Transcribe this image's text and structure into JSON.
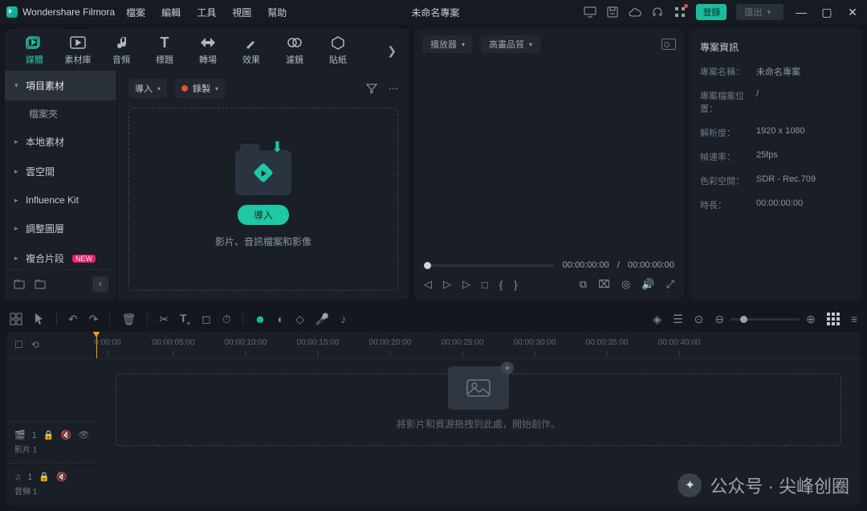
{
  "titlebar": {
    "brand": "Wondershare Filmora",
    "menu": [
      "檔案",
      "編輯",
      "工具",
      "視圖",
      "幫助"
    ],
    "project": "未命名專案",
    "login_label": "登錄",
    "export_label": "匯出"
  },
  "tabs": [
    {
      "id": "media",
      "label": "媒體",
      "active": true
    },
    {
      "id": "stock",
      "label": "素材庫"
    },
    {
      "id": "audio",
      "label": "音頻"
    },
    {
      "id": "title",
      "label": "標題"
    },
    {
      "id": "transition",
      "label": "轉場"
    },
    {
      "id": "effect",
      "label": "效果"
    },
    {
      "id": "filter",
      "label": "濾鏡"
    },
    {
      "id": "sticker",
      "label": "貼紙"
    }
  ],
  "sidebar": {
    "items": [
      {
        "label": "項目素材",
        "active": true
      },
      {
        "label": "本地素材"
      },
      {
        "label": "雲空間"
      },
      {
        "label": "Influence Kit"
      },
      {
        "label": "調整圖層"
      },
      {
        "label": "複合片段",
        "badge": "NEW"
      }
    ],
    "sub_label": "檔案夾"
  },
  "mediabar": {
    "import_label": "導入",
    "record_label": "錄製"
  },
  "dropzone": {
    "button": "導入",
    "hint": "影片、音訊檔案和影像"
  },
  "preview": {
    "player_label": "播放器",
    "quality_label": "高畫品質",
    "time_current": "00:00:00:00",
    "time_total": "00:00:00:00"
  },
  "info": {
    "title": "專案資訊",
    "rows": [
      {
        "k": "專案名稱：",
        "v": "未命名專案"
      },
      {
        "k": "專案檔案位置：",
        "v": "/"
      },
      {
        "k": "解析度：",
        "v": "1920 x 1080"
      },
      {
        "k": "幀速率：",
        "v": "25fps"
      },
      {
        "k": "色彩空間：",
        "v": "SDR - Rec.709"
      },
      {
        "k": "時長：",
        "v": "00:00:00:00"
      }
    ]
  },
  "timeline": {
    "ruler_start": "0:00:00",
    "ruler_marks": [
      "00:00:05:00",
      "00:00:10:00",
      "00:00:15:00",
      "00:00:20:00",
      "00:00:25:00",
      "00:00:30:00",
      "00:00:35:00",
      "00:00:40:00"
    ],
    "drop_hint": "將影片和資源拖拽到此處，開始創作。",
    "tracks": [
      {
        "icon": "camera",
        "num": "1",
        "label": "影片 1"
      },
      {
        "icon": "music",
        "num": "1",
        "label": "音頻 1"
      }
    ]
  },
  "watermark": {
    "prefix": "公众号 · ",
    "name": "尖峰创圈"
  }
}
